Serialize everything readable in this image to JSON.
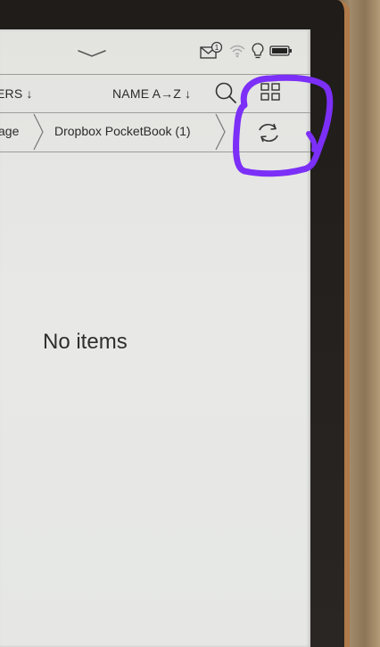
{
  "toolbar": {
    "sort_left_label": "ERS ↓",
    "sort_right_label": "NAME A→Z ↓",
    "icons": {
      "search": "search-icon",
      "grid": "grid-view-icon"
    }
  },
  "breadcrumb": {
    "items": [
      {
        "label": "age"
      },
      {
        "label": "Dropbox PocketBook (1)"
      }
    ],
    "refresh_icon": "refresh-icon"
  },
  "status_bar": {
    "notification_count": "1",
    "icons": [
      "mail-notification-icon",
      "wifi-icon",
      "frontlight-icon",
      "battery-icon"
    ]
  },
  "main": {
    "empty_message": "No items"
  },
  "colors": {
    "screen": "#e6e7e5",
    "text": "#2b2b2b",
    "divider": "#9c9c9a",
    "annotation": "#7b2ff7"
  }
}
